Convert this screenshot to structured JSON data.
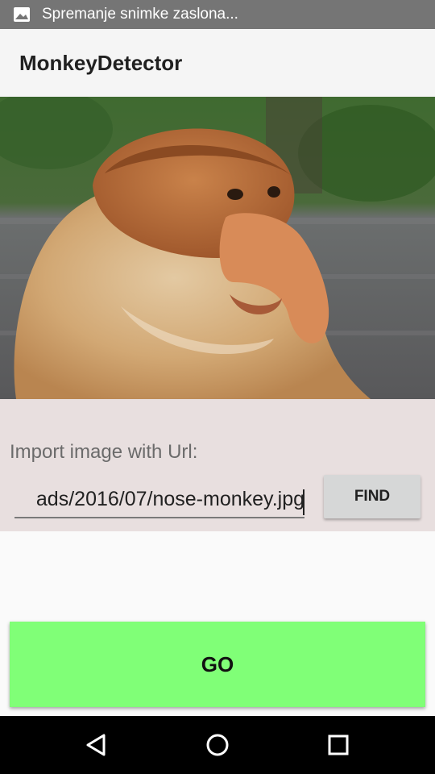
{
  "status_bar": {
    "notification_text": "Spremanje snimke zaslona...",
    "icon": "image-icon"
  },
  "app_bar": {
    "title": "MonkeyDetector"
  },
  "photo": {
    "subject": "proboscis monkey photo",
    "icon": "monkey-image"
  },
  "url_panel": {
    "label": "Import image with Url:",
    "url_value": "ads/2016/07/nose-monkey.jpg",
    "find_label": "FIND"
  },
  "go_label": "GO",
  "nav_bar": {
    "icons": [
      "back-icon",
      "home-icon",
      "recents-icon"
    ]
  },
  "colors": {
    "go_button": "#80ff77",
    "panel": "#e8dfdf",
    "status_bar": "#757575"
  }
}
